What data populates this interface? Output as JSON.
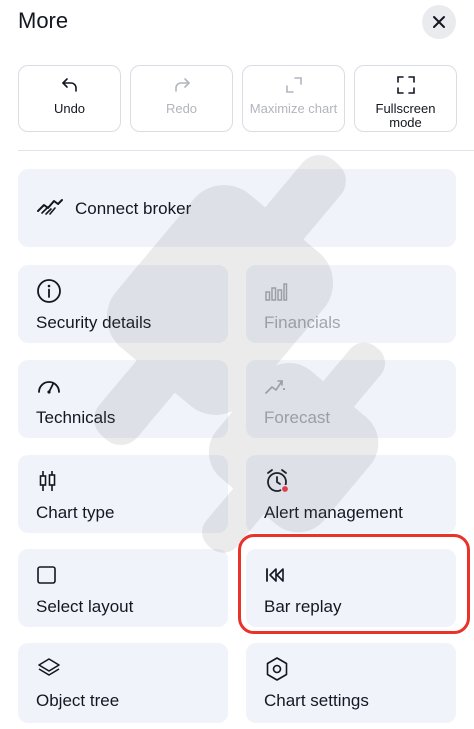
{
  "header": {
    "title": "More",
    "close_icon": "close-icon"
  },
  "toolbar": [
    {
      "label": "Undo",
      "icon": "undo-icon",
      "disabled": false
    },
    {
      "label": "Redo",
      "icon": "redo-icon",
      "disabled": true
    },
    {
      "label": "Maximize chart",
      "icon": "maximize-icon",
      "disabled": true
    },
    {
      "label": "Fullscreen\nmode",
      "icon": "fullscreen-icon",
      "disabled": false
    }
  ],
  "connect_broker": {
    "label": "Connect broker",
    "icon": "handshake-icon"
  },
  "grid": [
    {
      "label": "Security details",
      "icon": "info-icon",
      "disabled": false
    },
    {
      "label": "Financials",
      "icon": "bar-chart-icon",
      "disabled": true
    },
    {
      "label": "Technicals",
      "icon": "gauge-icon",
      "disabled": false
    },
    {
      "label": "Forecast",
      "icon": "forecast-icon",
      "disabled": true
    },
    {
      "label": "Chart type",
      "icon": "candlestick-icon",
      "disabled": false
    },
    {
      "label": "Alert management",
      "icon": "alarm-clock-icon",
      "disabled": false
    },
    {
      "label": "Select layout",
      "icon": "square-icon",
      "disabled": false
    },
    {
      "label": "Bar replay",
      "icon": "rewind-icon",
      "disabled": false
    },
    {
      "label": "Object tree",
      "icon": "layers-icon",
      "disabled": false
    },
    {
      "label": "Chart settings",
      "icon": "hexagon-settings-icon",
      "disabled": false
    }
  ],
  "colors": {
    "tile_bg": "#f0f3fa",
    "text": "#131722",
    "disabled_text": "#a3a6af",
    "highlight": "#e8322a",
    "alert_dot": "#f23645"
  }
}
